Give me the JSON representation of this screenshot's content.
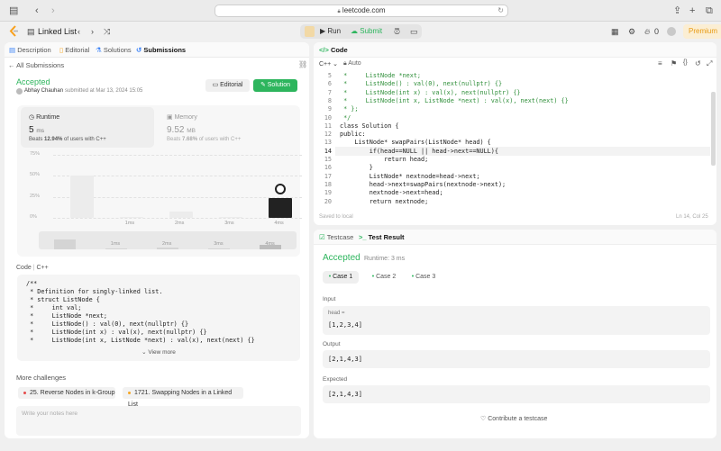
{
  "browser": {
    "url": "leetcode.com"
  },
  "appbar": {
    "list_title": "Linked List",
    "run": "Run",
    "submit": "Submit",
    "streak": "0",
    "premium": "Premium"
  },
  "left_tabs": [
    "Description",
    "Editorial",
    "Solutions",
    "Submissions"
  ],
  "submission": {
    "back_label": "All Submissions",
    "status": "Accepted",
    "user": "Abhay Chauhan",
    "submitted_at": "submitted at Mar 13, 2024 15:05",
    "editorial_btn": "Editorial",
    "solution_btn": "Solution",
    "runtime_label": "Runtime",
    "runtime_value": "5",
    "runtime_unit": "ms",
    "runtime_beats_pre": "Beats ",
    "runtime_beats_pct": "12.94%",
    "runtime_beats_post": " of users with C++",
    "memory_label": "Memory",
    "memory_value": "9.52",
    "memory_unit": "MB",
    "memory_beats_pre": "Beats ",
    "memory_beats_pct": "7.68%",
    "memory_beats_post": " of users with C++"
  },
  "chart_data": {
    "type": "bar",
    "categories": [
      "",
      "1ms",
      "2ms",
      "3ms",
      "4ms"
    ],
    "values": [
      50,
      1,
      8,
      1,
      24
    ],
    "highlight_index": 4,
    "yticks": [
      "75%",
      "50%",
      "25%",
      "0%"
    ],
    "ylim": [
      0,
      75
    ]
  },
  "code_section": {
    "label": "Code",
    "lang": "C++",
    "lines": [
      "/**",
      " * Definition for singly-linked list.",
      " * struct ListNode {",
      " *     int val;",
      " *     ListNode *next;",
      " *     ListNode() : val(0), next(nullptr) {}",
      " *     ListNode(int x) : val(x), next(nullptr) {}",
      " *     ListNode(int x, ListNode *next) : val(x), next(next) {}"
    ],
    "view_more": "View more"
  },
  "more_challenges": {
    "title": "More challenges",
    "items": [
      "25. Reverse Nodes in k-Group",
      "1721. Swapping Nodes in a Linked List"
    ]
  },
  "notes_placeholder": "Write your notes here",
  "editor": {
    "title": "Code",
    "lang": "C++",
    "mode": "Auto",
    "saved": "Saved to local",
    "position": "Ln 14, Col 25",
    "line_numbers": [
      "5",
      "6",
      "7",
      "8",
      "9",
      "10",
      "11",
      "12",
      "13",
      "14",
      "15",
      "16",
      "17",
      "18",
      "19",
      "20"
    ],
    "lines": [
      " *     ListNode *next;",
      " *     ListNode() : val(0), next(nullptr) {}",
      " *     ListNode(int x) : val(x), next(nullptr) {}",
      " *     ListNode(int x, ListNode *next) : val(x), next(next) {}",
      " * };",
      " */",
      "class Solution {",
      "public:",
      "    ListNode* swapPairs(ListNode* head) {",
      "        if(head==NULL || head->next==NULL){",
      "            return head;",
      "        }",
      "        ListNode* nextnode=head->next;",
      "        head->next=swapPairs(nextnode->next);",
      "        nextnode->next=head;",
      "        return nextnode;"
    ]
  },
  "test": {
    "tab_testcase": "Testcase",
    "tab_result": "Test Result",
    "status": "Accepted",
    "runtime": "Runtime: 3 ms",
    "cases": [
      "Case 1",
      "Case 2",
      "Case 3"
    ],
    "input_label": "Input",
    "input_var": "head =",
    "input_value": "[1,2,3,4]",
    "output_label": "Output",
    "output_value": "[2,1,4,3]",
    "expected_label": "Expected",
    "expected_value": "[2,1,4,3]",
    "contribute": "Contribute a testcase"
  },
  "colors": {
    "accepted": "#2db55d",
    "accent": "#ffa116",
    "run_green": "#2db55d"
  }
}
